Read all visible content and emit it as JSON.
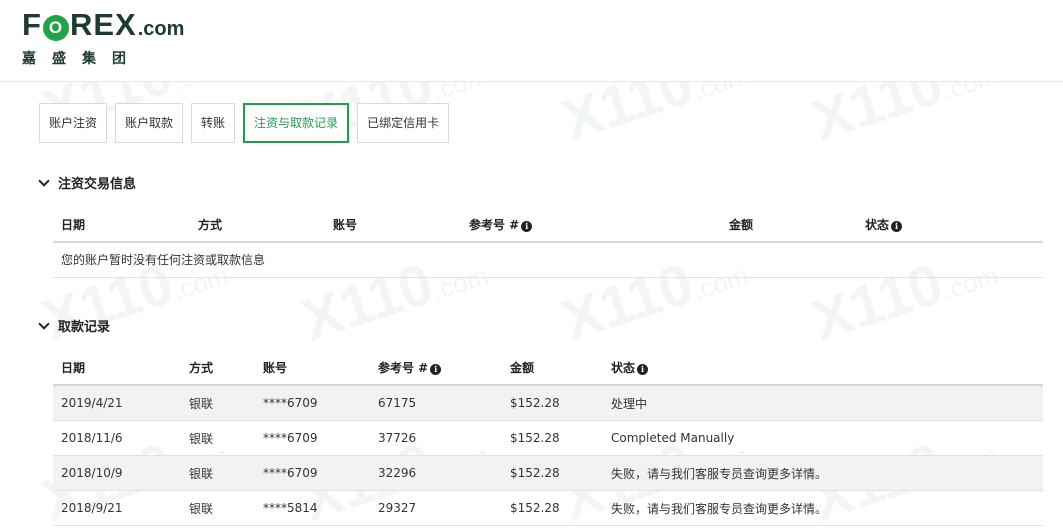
{
  "brand": {
    "logo_text_1": "F",
    "logo_o": "O",
    "logo_text_2": "REX",
    "logo_dotcom": ".com",
    "logo_sub": "嘉盛集团"
  },
  "tabs": [
    {
      "label": "账户注资",
      "active": false
    },
    {
      "label": "账户取款",
      "active": false
    },
    {
      "label": "转账",
      "active": false
    },
    {
      "label": "注资与取款记录",
      "active": true
    },
    {
      "label": "已绑定信用卡",
      "active": false
    }
  ],
  "deposit_section": {
    "title": "注资交易信息",
    "headers": {
      "date": "日期",
      "method": "方式",
      "account": "账号",
      "ref": "参考号 #",
      "amount": "金额",
      "status": "状态"
    },
    "empty_message": "您的账户暂时没有任何注资或取款信息"
  },
  "withdraw_section": {
    "title": "取款记录",
    "headers": {
      "date": "日期",
      "method": "方式",
      "account": "账号",
      "ref": "参考号 #",
      "amount": "金额",
      "status": "状态"
    },
    "rows": [
      {
        "date": "2019/4/21",
        "method": "银联",
        "account": "****6709",
        "ref": "67175",
        "amount": "$152.28",
        "status": "处理中"
      },
      {
        "date": "2018/11/6",
        "method": "银联",
        "account": "****6709",
        "ref": "37726",
        "amount": "$152.28",
        "status": "Completed Manually"
      },
      {
        "date": "2018/10/9",
        "method": "银联",
        "account": "****6709",
        "ref": "32296",
        "amount": "$152.28",
        "status": "失败，请与我们客服专员查询更多详情。"
      },
      {
        "date": "2018/9/21",
        "method": "银联",
        "account": "****5814",
        "ref": "29327",
        "amount": "$152.28",
        "status": "失败，请与我们客服专员查询更多详情。"
      }
    ]
  },
  "icons": {
    "info": "info-circle-icon",
    "chevron": "chevron-down-icon"
  },
  "colors": {
    "accent": "#1f9e4c",
    "brand_dark": "#1f3a33",
    "logo_green": "#22a34a"
  },
  "watermark": {
    "main": "X110",
    "suffix": ".com"
  }
}
